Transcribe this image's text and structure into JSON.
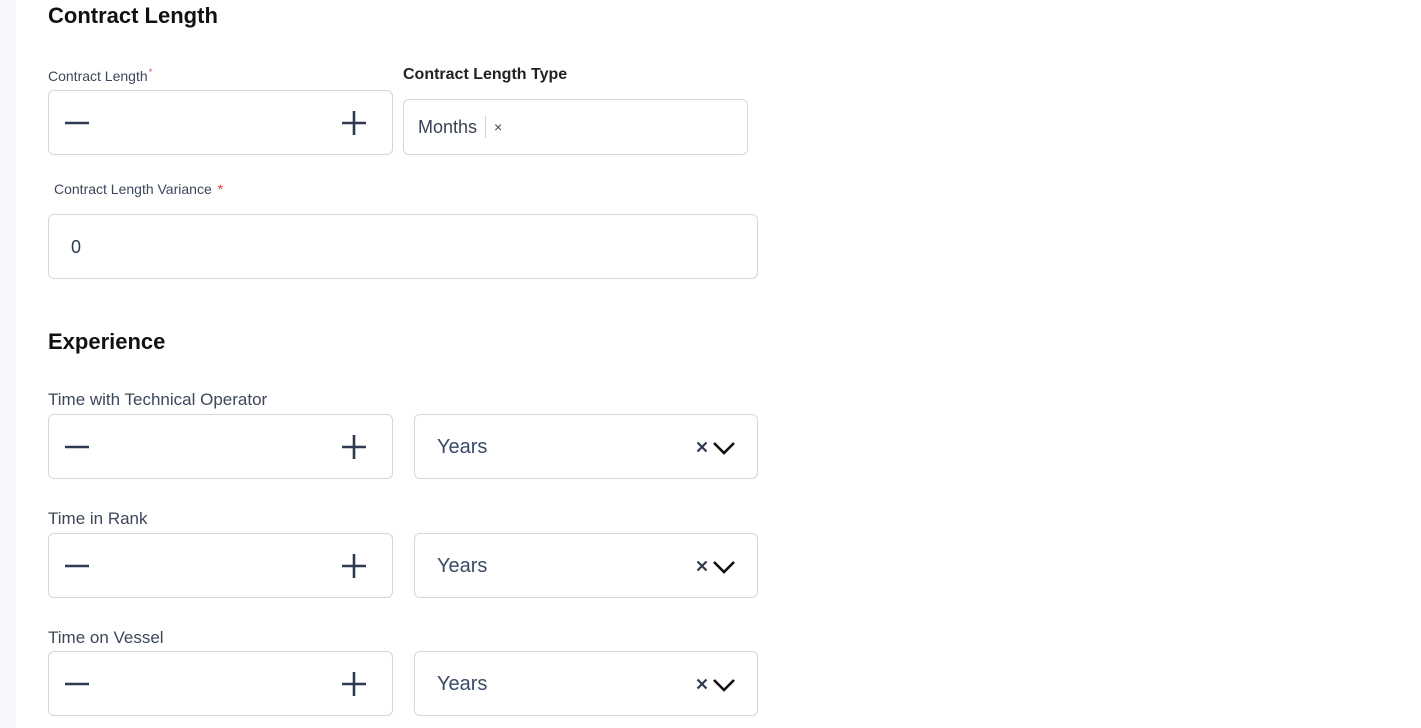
{
  "contract_length_section": {
    "title": "Contract Length",
    "contract_length": {
      "label": "Contract Length",
      "required_mark": "*",
      "value": "",
      "decrement_icon": "minus-icon",
      "increment_icon": "plus-icon"
    },
    "contract_length_type": {
      "label": "Contract Length Type",
      "selected": "Months",
      "remove_icon": "×"
    },
    "contract_length_variance": {
      "label": "Contract Length Variance",
      "required_mark": "*",
      "value": "0"
    }
  },
  "experience_section": {
    "title": "Experience",
    "fields": [
      {
        "label": "Time with Technical Operator",
        "value": "",
        "unit": "Years"
      },
      {
        "label": "Time in Rank",
        "value": "",
        "unit": "Years"
      },
      {
        "label": "Time on Vessel",
        "value": "",
        "unit": "Years"
      }
    ],
    "clear_icon": "×",
    "chevron_icon": "chevron-down-icon"
  },
  "colors": {
    "required": "#e0393e",
    "icon": "#2d3a52",
    "border": "#d3d6db",
    "rail": "#f5f7fa"
  }
}
